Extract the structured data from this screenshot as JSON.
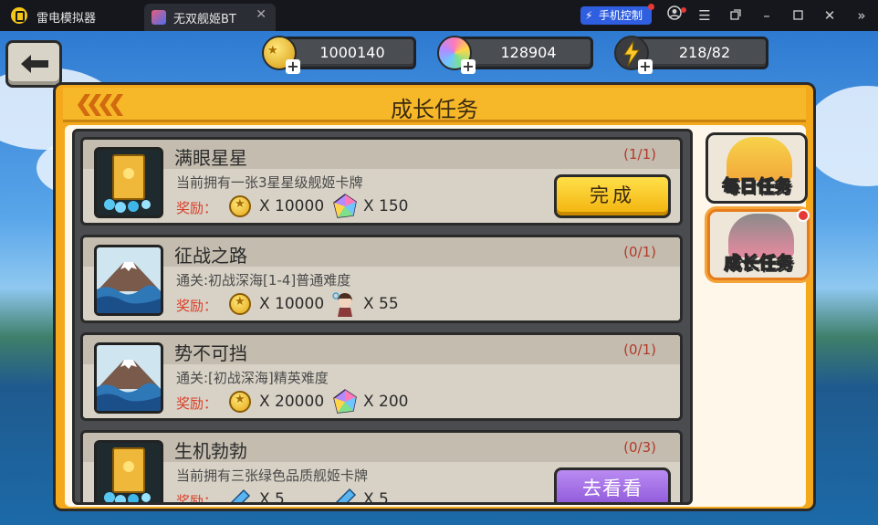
{
  "titlebar": {
    "app_name": "雷电模拟器",
    "tab_title": "无双舰姬BT",
    "tab_close": "✕",
    "phone_control": "手机控制",
    "icons": [
      "account-icon",
      "menu-icon",
      "restore-icon",
      "minimize-icon",
      "maximize-icon",
      "close-icon",
      "collapse-icon"
    ]
  },
  "resources": {
    "gold": "1000140",
    "gems": "128904",
    "energy": "218/82"
  },
  "panel": {
    "title": "成长任务"
  },
  "side_tabs": [
    {
      "label": "每日任务",
      "active": false
    },
    {
      "label": "成长任务",
      "active": true
    }
  ],
  "reward_label": "奖励：",
  "tasks": [
    {
      "name": "满眼星星",
      "progress": "(1/1)",
      "desc": "当前拥有一张3星星级舰姬卡牌",
      "reward1_icon": "gold-coin-icon",
      "reward1": "X 10000",
      "reward2_icon": "rainbow-gem-icon",
      "reward2": "X 150",
      "action": "完成",
      "action_type": "done"
    },
    {
      "name": "征战之路",
      "progress": "(0/1)",
      "desc": "通关:初战深海[1-4]普通难度",
      "reward1_icon": "gold-coin-icon",
      "reward1": "X 10000",
      "reward2_icon": "character-icon",
      "reward2": "X 55",
      "action": "",
      "action_type": "none"
    },
    {
      "name": "势不可挡",
      "progress": "(0/1)",
      "desc": "通关:[初战深海]精英难度",
      "reward1_icon": "gold-coin-icon",
      "reward1": "X 20000",
      "reward2_icon": "rainbow-gem-icon",
      "reward2": "X 200",
      "action": "",
      "action_type": "none"
    },
    {
      "name": "生机勃勃",
      "progress": "(0/3)",
      "desc": "当前拥有三张绿色品质舰姬卡牌",
      "reward1_icon": "blue-ticket-icon",
      "reward1": "X 5",
      "reward2_icon": "blue-ticket-icon",
      "reward2": "X 5",
      "action": "去看看",
      "action_type": "go"
    }
  ]
}
